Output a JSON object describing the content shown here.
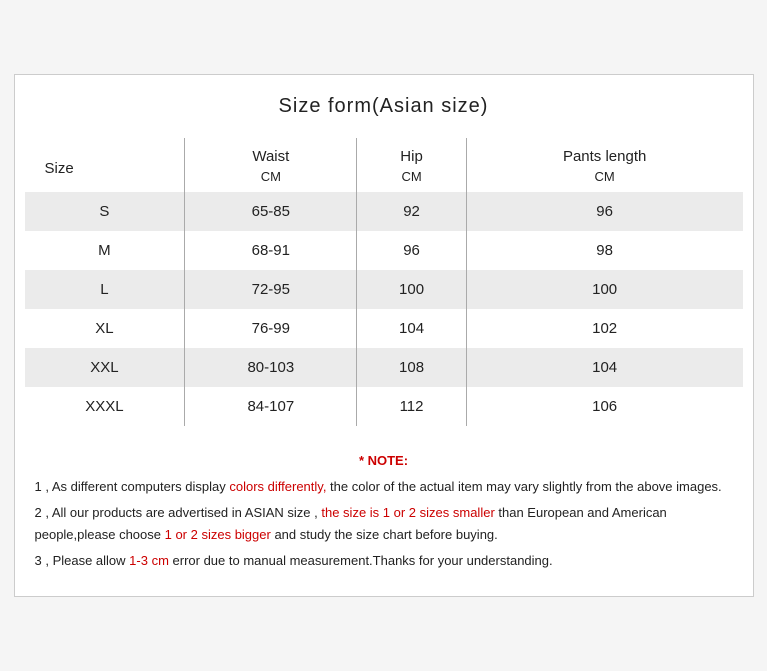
{
  "title": "Size form(Asian size)",
  "table": {
    "headers": {
      "size_label": "Size",
      "waist_label": "Waist",
      "hip_label": "Hip",
      "pants_label": "Pants length",
      "waist_unit": "CM",
      "hip_unit": "CM",
      "pants_unit": "CM"
    },
    "rows": [
      {
        "size": "S",
        "waist": "65-85",
        "hip": "92",
        "pants": "96"
      },
      {
        "size": "M",
        "waist": "68-91",
        "hip": "96",
        "pants": "98"
      },
      {
        "size": "L",
        "waist": "72-95",
        "hip": "100",
        "pants": "100"
      },
      {
        "size": "XL",
        "waist": "76-99",
        "hip": "104",
        "pants": "102"
      },
      {
        "size": "XXL",
        "waist": "80-103",
        "hip": "108",
        "pants": "104"
      },
      {
        "size": "XXXL",
        "waist": "84-107",
        "hip": "112",
        "pants": "106"
      }
    ]
  },
  "notes": {
    "title": "* NOTE:",
    "note1_a": "1 , As different computers display ",
    "note1_red": "colors differently,",
    "note1_b": " the color of the actual item may vary slightly from the above images.",
    "note2_a": "2 , All our products are advertised in ASIAN size , ",
    "note2_red1": "the size is 1 or 2 sizes smaller",
    "note2_b": " than European and American people,please choose ",
    "note2_red2": "1 or 2 sizes bigger",
    "note2_c": " and study the size chart before buying.",
    "note3_a": "3 , Please allow ",
    "note3_red": "1-3 cm",
    "note3_b": " error due to manual measurement.Thanks for your understanding."
  }
}
